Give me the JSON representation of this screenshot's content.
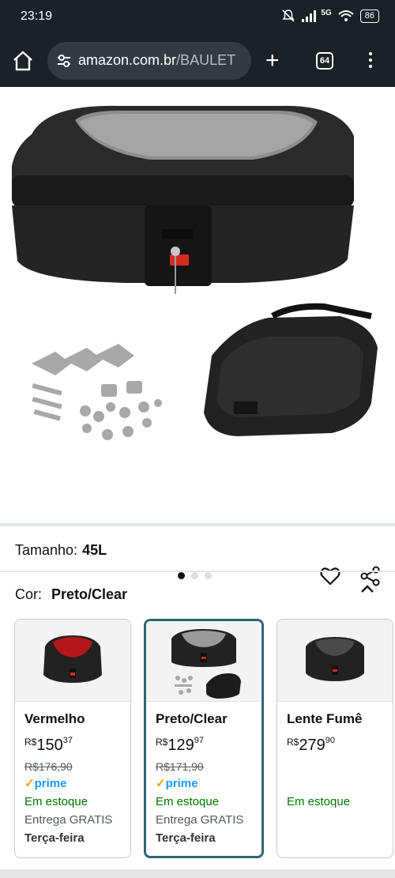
{
  "status_bar": {
    "time": "23:19",
    "network": "5G",
    "battery": "86"
  },
  "browser": {
    "url_host": "amazon.com.br",
    "url_rest": "/BAULET",
    "tab_count": "64"
  },
  "gallery": {
    "image_count": 3,
    "active_index": 0
  },
  "size": {
    "label": "Tamanho:",
    "value": "45L"
  },
  "color": {
    "label": "Cor:",
    "value": "Preto/Clear"
  },
  "variants": [
    {
      "name": "Vermelho",
      "currency": "R$",
      "price_whole": "150",
      "price_cents": "37",
      "list_price": "R$176,90",
      "prime": "prime",
      "stock": "Em estoque",
      "delivery": "Entrega GRATIS",
      "day": "Terça-feira",
      "selected": false
    },
    {
      "name": "Preto/Clear",
      "currency": "R$",
      "price_whole": "129",
      "price_cents": "97",
      "list_price": "R$171,90",
      "prime": "prime",
      "stock": "Em estoque",
      "delivery": "Entrega GRATIS",
      "day": "Terça-feira",
      "selected": true
    },
    {
      "name": "Lente Fumê",
      "currency": "R$",
      "price_whole": "279",
      "price_cents": "90",
      "stock": "Em estoque",
      "selected": false
    }
  ],
  "colors": {
    "chrome": "#1c2027",
    "urlbar": "#343a44",
    "selected_border": "#2e6574",
    "stock_green": "#007600",
    "prime_blue": "#1a98ff"
  }
}
